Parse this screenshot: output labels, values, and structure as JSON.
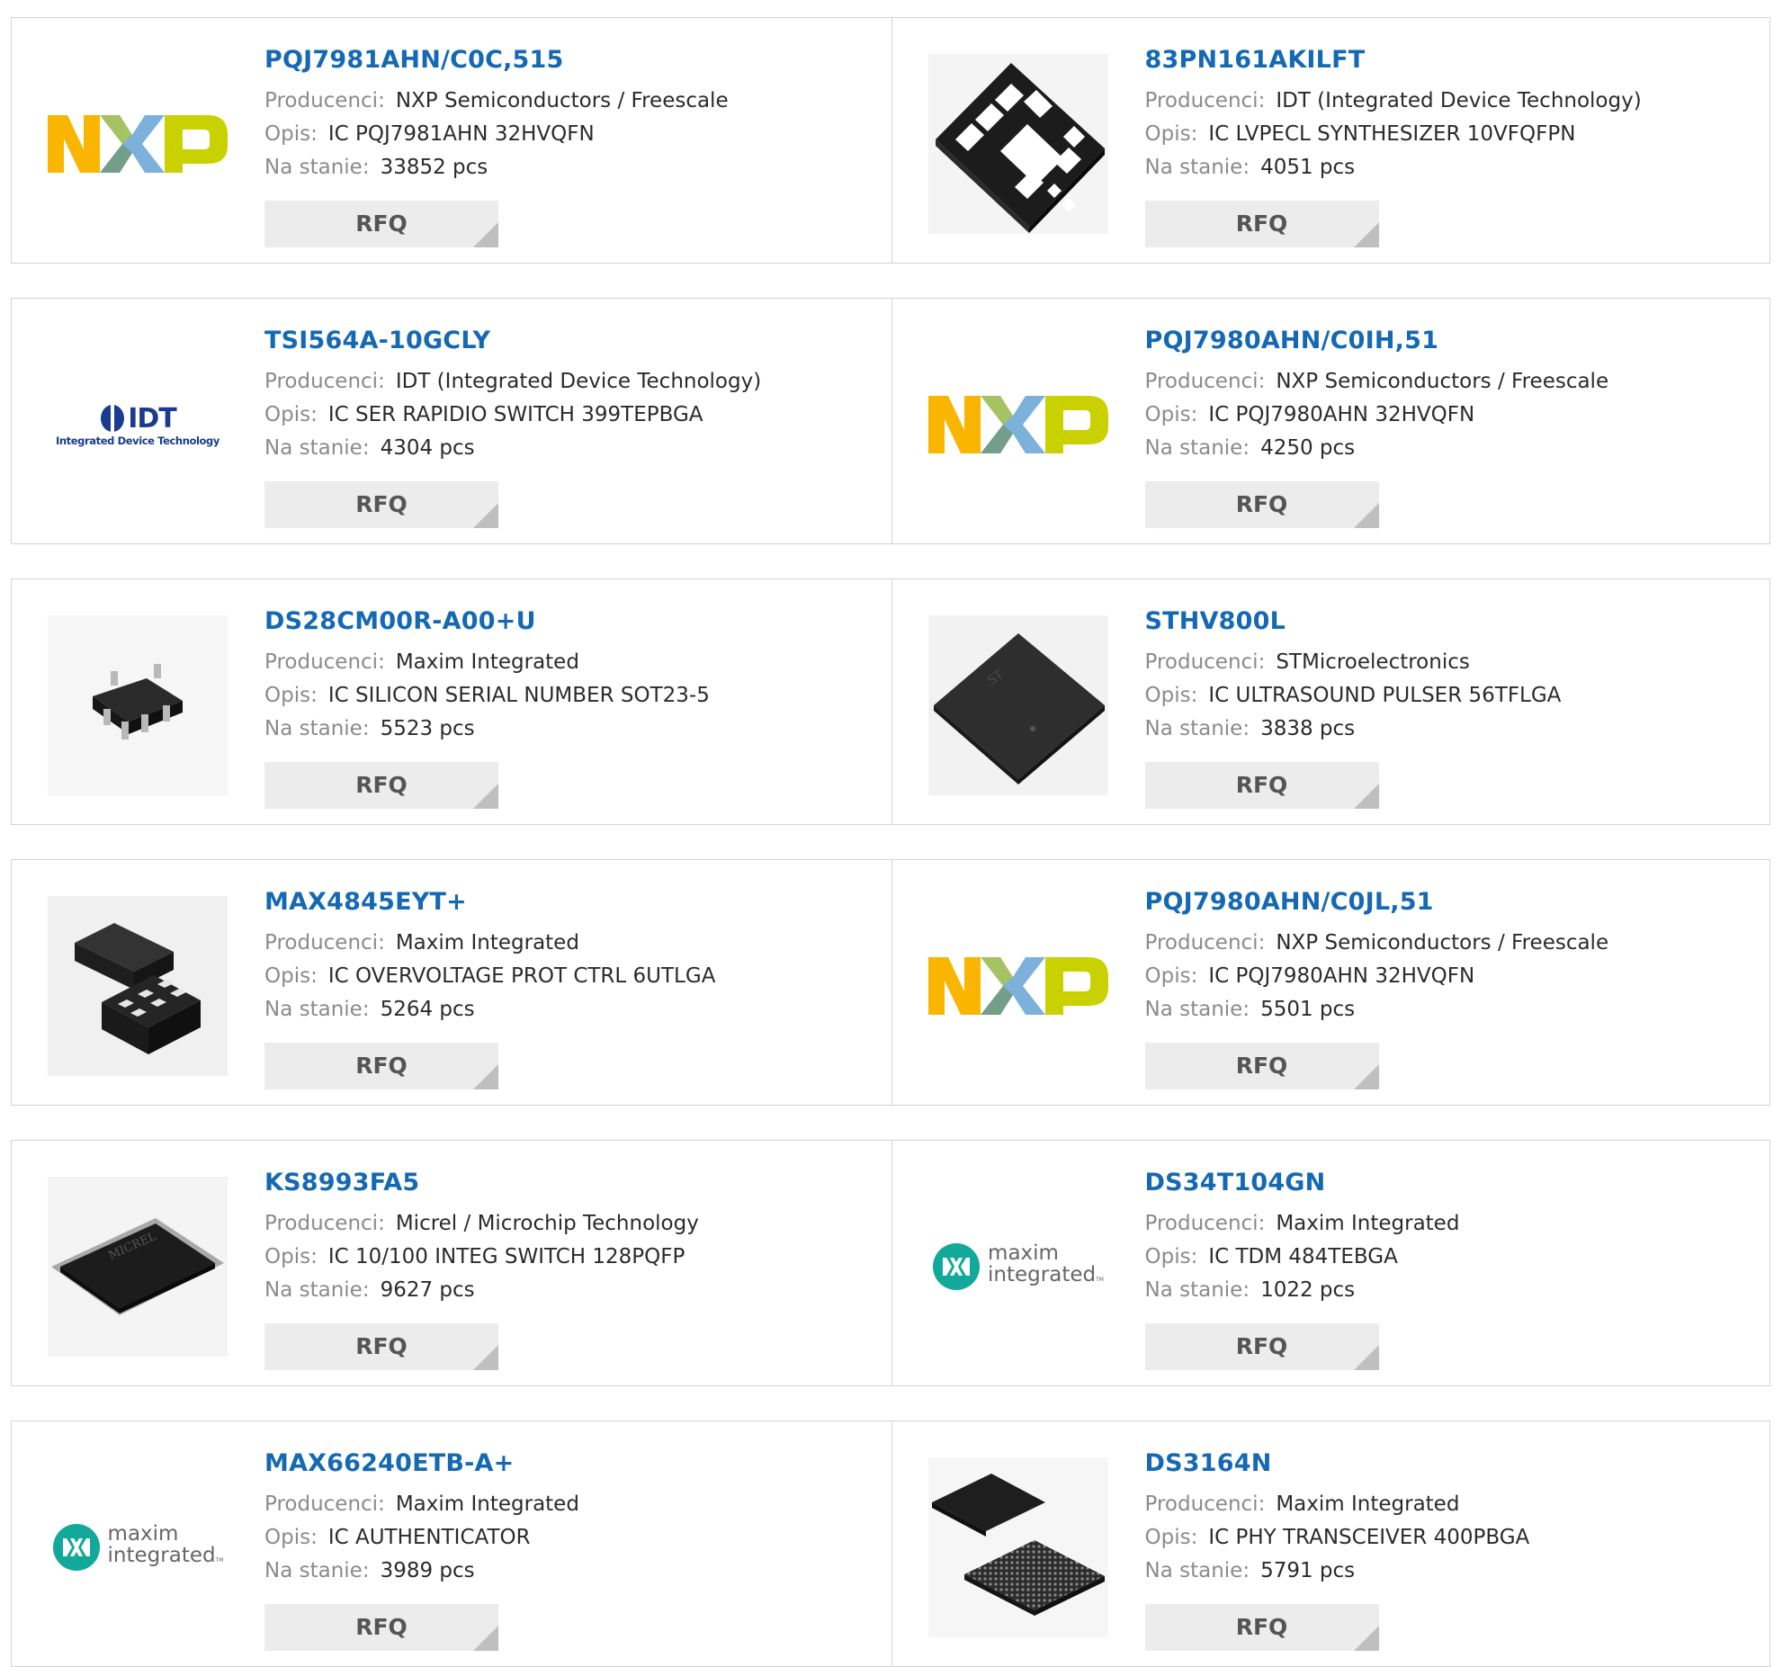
{
  "labels": {
    "manufacturer": "Producenci:",
    "description": "Opis:",
    "stock": "Na stanie:",
    "rfq": "RFQ"
  },
  "logos": {
    "idt_mark": "IDT",
    "idt_sub": "Integrated Device Technology",
    "maxim_line1": "maxim",
    "maxim_line2": "integrated",
    "maxim_tm": "TM",
    "micrel": "MICREL"
  },
  "products": [
    {
      "part": "PQJ7981AHN/C0C,515",
      "manufacturer": "NXP Semiconductors / Freescale",
      "description": "IC PQJ7981AHN 32HVQFN",
      "stock": "33852 pcs",
      "image": "nxp-logo"
    },
    {
      "part": "83PN161AKILFT",
      "manufacturer": "IDT (Integrated Device Technology)",
      "description": "IC LVPECL SYNTHESIZER 10VFQFPN",
      "stock": "4051 pcs",
      "image": "vfqfpn-chip"
    },
    {
      "part": "TSI564A-10GCLY",
      "manufacturer": "IDT (Integrated Device Technology)",
      "description": "IC SER RAPIDIO SWITCH 399TEPBGA",
      "stock": "4304 pcs",
      "image": "idt-logo"
    },
    {
      "part": "PQJ7980AHN/C0IH,51",
      "manufacturer": "NXP Semiconductors / Freescale",
      "description": "IC PQJ7980AHN 32HVQFN",
      "stock": "4250 pcs",
      "image": "nxp-logo"
    },
    {
      "part": "DS28CM00R-A00+U",
      "manufacturer": "Maxim Integrated",
      "description": "IC SILICON SERIAL NUMBER SOT23-5",
      "stock": "5523 pcs",
      "image": "sot23-chip"
    },
    {
      "part": "STHV800L",
      "manufacturer": "STMicroelectronics",
      "description": "IC ULTRASOUND PULSER 56TFLGA",
      "stock": "3838 pcs",
      "image": "tflga-chip"
    },
    {
      "part": "MAX4845EYT+",
      "manufacturer": "Maxim Integrated",
      "description": "IC OVERVOLTAGE PROT CTRL 6UTLGA",
      "stock": "5264 pcs",
      "image": "utlga-chip"
    },
    {
      "part": "PQJ7980AHN/C0JL,51",
      "manufacturer": "NXP Semiconductors / Freescale",
      "description": "IC PQJ7980AHN 32HVQFN",
      "stock": "5501 pcs",
      "image": "nxp-logo"
    },
    {
      "part": "KS8993FA5",
      "manufacturer": "Micrel / Microchip Technology",
      "description": "IC 10/100 INTEG SWITCH 128PQFP",
      "stock": "9627 pcs",
      "image": "pqfp-chip"
    },
    {
      "part": "DS34T104GN",
      "manufacturer": "Maxim Integrated",
      "description": "IC TDM 484TEBGA",
      "stock": "1022 pcs",
      "image": "maxim-logo"
    },
    {
      "part": "MAX66240ETB-A+",
      "manufacturer": "Maxim Integrated",
      "description": "IC AUTHENTICATOR",
      "stock": "3989 pcs",
      "image": "maxim-logo"
    },
    {
      "part": "DS3164N",
      "manufacturer": "Maxim Integrated",
      "description": "IC PHY TRANSCEIVER 400PBGA",
      "stock": "5791 pcs",
      "image": "pbga-chip"
    }
  ]
}
